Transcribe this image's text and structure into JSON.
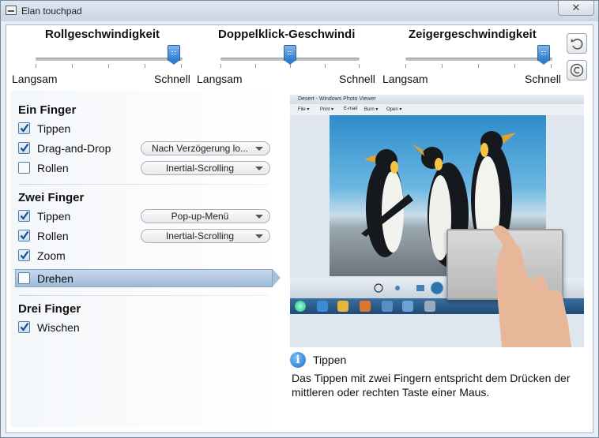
{
  "window": {
    "title": "Elan touchpad",
    "close_glyph": "✕"
  },
  "sliders": [
    {
      "title": "Rollgeschwindigkeit",
      "min_label": "Langsam",
      "max_label": "Schnell",
      "value": 0.95
    },
    {
      "title": "Doppelklick-Geschwindi",
      "min_label": "Langsam",
      "max_label": "Schnell",
      "value": 0.5
    },
    {
      "title": "Zeigergeschwindigkeit",
      "min_label": "Langsam",
      "max_label": "Schnell",
      "value": 0.95
    }
  ],
  "toolbar": {
    "reset_icon": "undo-icon",
    "copyright_icon": "copyright-icon"
  },
  "groups": {
    "one_finger": {
      "title": "Ein Finger",
      "tap": {
        "label": "Tippen",
        "checked": true
      },
      "drag": {
        "label": "Drag-and-Drop",
        "checked": true,
        "option": "Nach Verzögerung lo..."
      },
      "scroll": {
        "label": "Rollen",
        "checked": false,
        "option": "Inertial-Scrolling"
      }
    },
    "two_finger": {
      "title": "Zwei Finger",
      "tap": {
        "label": "Tippen",
        "checked": true,
        "option": "Pop-up-Menü"
      },
      "scroll": {
        "label": "Rollen",
        "checked": true,
        "option": "Inertial-Scrolling"
      },
      "zoom": {
        "label": "Zoom",
        "checked": true
      },
      "rotate": {
        "label": "Drehen",
        "checked": false,
        "selected": true
      }
    },
    "three_finger": {
      "title": "Drei Finger",
      "swipe": {
        "label": "Wischen",
        "checked": true
      }
    }
  },
  "preview": {
    "window_title": "Desert - Windows Photo Viewer",
    "menu": [
      "File ▾",
      "Print ▾",
      "E-mail",
      "Burn ▾",
      "Open ▾"
    ]
  },
  "info": {
    "title": "Tippen",
    "description": "Das Tippen mit zwei Fingern entspricht dem Drücken der mittleren oder rechten Taste einer Maus."
  },
  "colors": {
    "accent": "#2f7fd1",
    "selection": "#a7c1dc",
    "info": "#1f6fc2"
  }
}
